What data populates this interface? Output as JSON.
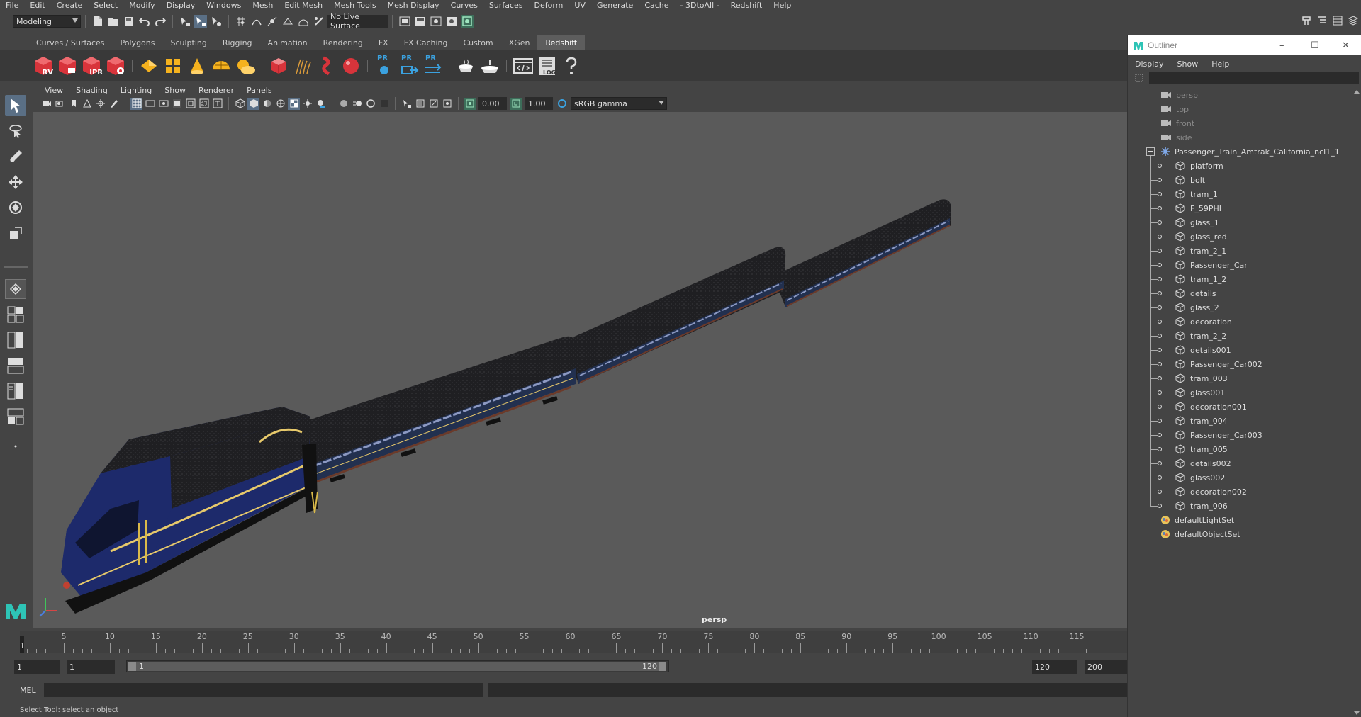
{
  "menubar": [
    "File",
    "Edit",
    "Create",
    "Select",
    "Modify",
    "Display",
    "Windows",
    "Mesh",
    "Edit Mesh",
    "Mesh Tools",
    "Mesh Display",
    "Curves",
    "Surfaces",
    "Deform",
    "UV",
    "Generate",
    "Cache",
    "- 3DtoAll -",
    "Redshift",
    "Help"
  ],
  "statusline": {
    "workspace": "Modeling",
    "live_surface": "No Live Surface"
  },
  "shelf": {
    "tabs": [
      "Curves / Surfaces",
      "Polygons",
      "Sculpting",
      "Rigging",
      "Animation",
      "Rendering",
      "FX",
      "FX Caching",
      "Custom",
      "XGen",
      "Redshift"
    ],
    "active_tab": "Redshift",
    "icon_labels": {
      "rv": "RV",
      "ipr": "IPR",
      "pr": "PR",
      "log": "LOG"
    }
  },
  "viewport": {
    "menu": [
      "View",
      "Shading",
      "Lighting",
      "Show",
      "Renderer",
      "Panels"
    ],
    "exposure": "0.00",
    "gamma": "1.00",
    "color_space": "sRGB gamma",
    "camera": "persp"
  },
  "timeslider": {
    "ticks": [
      5,
      10,
      15,
      20,
      25,
      30,
      35,
      40,
      45,
      50,
      55,
      60,
      65,
      70,
      75,
      80,
      85,
      90,
      95,
      100,
      105,
      110,
      115
    ],
    "current_frame": "1"
  },
  "range": {
    "start": "1",
    "playback_start": "1",
    "range_start_label": "1",
    "range_end_label": "120",
    "playback_end": "120",
    "end": "200"
  },
  "cmdline": {
    "label": "MEL",
    "help": "Select Tool: select an object"
  },
  "outliner": {
    "title": "Outliner",
    "menu": [
      "Display",
      "Show",
      "Help"
    ],
    "cameras": [
      "persp",
      "top",
      "front",
      "side"
    ],
    "root": "Passenger_Train_Amtrak_California_ncl1_1",
    "children": [
      "platform",
      "bolt",
      "tram_1",
      "F_59PHI",
      "glass_1",
      "glass_red",
      "tram_2_1",
      "Passenger_Car",
      "tram_1_2",
      "details",
      "glass_2",
      "decoration",
      "tram_2_2",
      "details001",
      "Passenger_Car002",
      "tram_003",
      "glass001",
      "decoration001",
      "tram_004",
      "Passenger_Car003",
      "tram_005",
      "details002",
      "glass002",
      "decoration002",
      "tram_006"
    ],
    "sets": [
      "defaultLightSet",
      "defaultObjectSet"
    ]
  },
  "colors": {
    "accent": "#5a6f85",
    "redshift_red": "#d8343b",
    "active_tab": "#5d5d5d",
    "viewport_bg": "#5a5a5a"
  }
}
